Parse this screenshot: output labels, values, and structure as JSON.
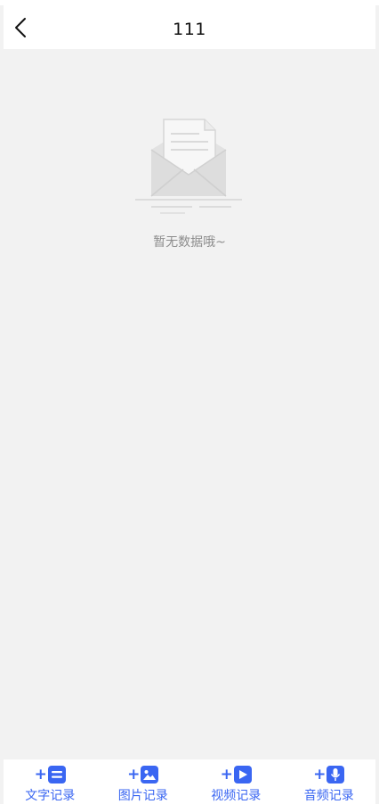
{
  "header": {
    "title": "111",
    "back_icon": "chevron-left-icon"
  },
  "empty_state": {
    "illustration": "empty-mailbox-illustration",
    "text": "暂无数据哦~"
  },
  "toolbar": {
    "items": [
      {
        "plus": "+",
        "icon": "text-record-icon",
        "label": "文字记录"
      },
      {
        "plus": "+",
        "icon": "image-record-icon",
        "label": "图片记录"
      },
      {
        "plus": "+",
        "icon": "video-record-icon",
        "label": "视频记录"
      },
      {
        "plus": "+",
        "icon": "audio-record-icon",
        "label": "音频记录"
      }
    ]
  },
  "colors": {
    "accent": "#3a66f2",
    "background": "#f2f2f2",
    "empty_text": "#8d8d8d"
  }
}
